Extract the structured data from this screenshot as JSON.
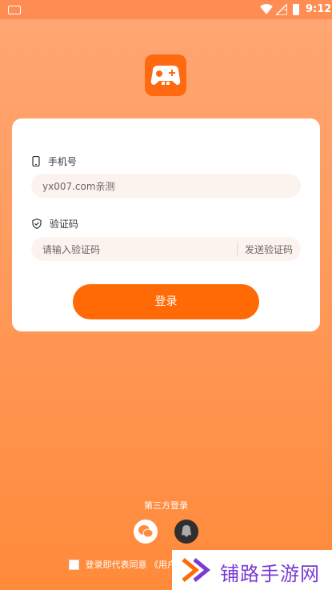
{
  "status_bar": {
    "time": "9:12"
  },
  "phone_field": {
    "label": "手机号",
    "value": "yx007.com亲测"
  },
  "code_field": {
    "label": "验证码",
    "placeholder": "请输入验证码",
    "send_code_label": "发送验证码"
  },
  "login_button": {
    "label": "登录"
  },
  "third_party": {
    "label": "第三方登录"
  },
  "agreement": {
    "text": "登录即代表同意 《用户"
  },
  "watermark": {
    "text": "铺路手游网"
  },
  "colors": {
    "accent": "#ff6a06",
    "background_top": "#ffa774",
    "background_bottom": "#ff8a3a"
  },
  "icons": [
    "keyboard-icon",
    "wifi-icon",
    "signal-icon",
    "battery-icon",
    "app-logo-icon",
    "phone-icon",
    "shield-icon",
    "wechat-icon",
    "qq-icon"
  ]
}
